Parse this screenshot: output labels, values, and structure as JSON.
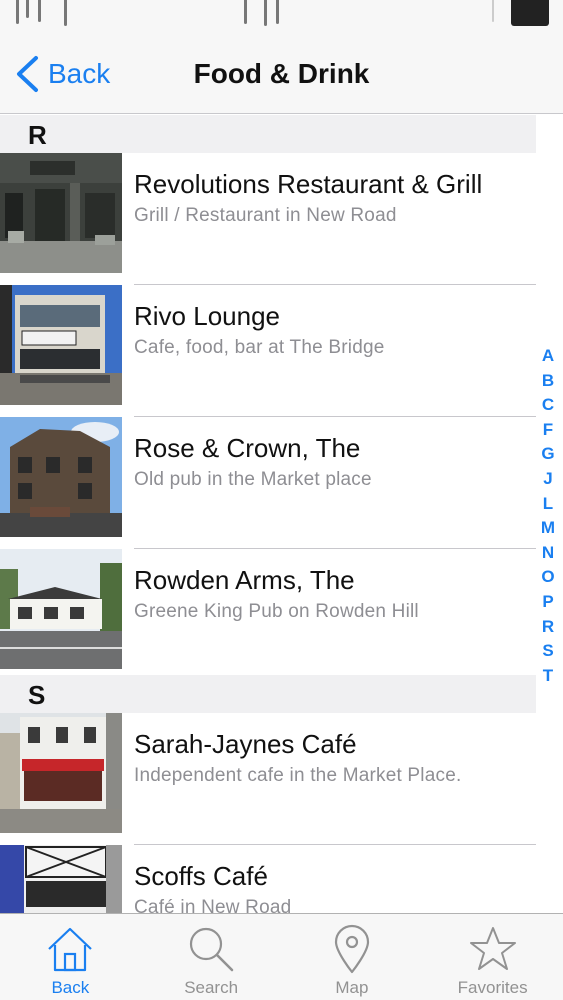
{
  "nav": {
    "back_label": "Back",
    "title": "Food & Drink"
  },
  "sections": [
    {
      "letter": "R",
      "rows": [
        {
          "title": "Revolutions Restaurant & Grill",
          "subtitle": "Grill / Restaurant in New Road",
          "thumb": "restaurant-photo"
        },
        {
          "title": "Rivo Lounge",
          "subtitle": "Cafe, food, bar at The Bridge",
          "thumb": "lounge-photo"
        },
        {
          "title": "Rose & Crown, The",
          "subtitle": "Old pub in the Market place",
          "thumb": "pub-photo"
        },
        {
          "title": "Rowden Arms, The",
          "subtitle": "Greene King Pub on Rowden Hill",
          "thumb": "pub-photo"
        }
      ]
    },
    {
      "letter": "S",
      "rows": [
        {
          "title": "Sarah-Jaynes Café",
          "subtitle": "Independent cafe in the Market Place.",
          "thumb": "cafe-photo"
        },
        {
          "title": "Scoffs Café",
          "subtitle": "Café in New Road",
          "thumb": "cafe-photo"
        }
      ]
    }
  ],
  "index_letters": [
    "A",
    "B",
    "C",
    "F",
    "G",
    "J",
    "L",
    "M",
    "N",
    "O",
    "P",
    "R",
    "S",
    "T"
  ],
  "tabs": [
    {
      "label": "Back",
      "icon": "home-icon",
      "active": true
    },
    {
      "label": "Search",
      "icon": "search-icon",
      "active": false
    },
    {
      "label": "Map",
      "icon": "map-pin-icon",
      "active": false
    },
    {
      "label": "Favorites",
      "icon": "star-icon",
      "active": false
    }
  ],
  "colors": {
    "accent": "#1a7ff0",
    "inactive": "#929292",
    "subtitle": "#8e8e93",
    "section_bg": "#f0f0f2"
  }
}
